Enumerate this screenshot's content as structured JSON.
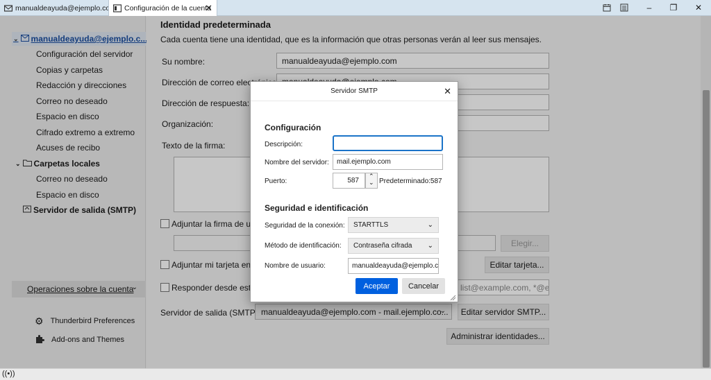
{
  "tabs": [
    {
      "label": "manualdeayuda@ejemplo.com",
      "icon": "mail-icon"
    },
    {
      "label": "Configuración de la cuenta",
      "icon": "settings-tab-icon"
    }
  ],
  "window_controls": {
    "minimize": "–",
    "restore": "❐",
    "close": "✕"
  },
  "sidebar": {
    "account": "manualdeayuda@ejemplo.c...",
    "account_items": [
      "Configuración del servidor",
      "Copias y carpetas",
      "Redacción y direcciones",
      "Correo no deseado",
      "Espacio en disco",
      "Cifrado extremo a extremo",
      "Acuses de recibo"
    ],
    "local_folders": "Carpetas locales",
    "local_items": [
      "Correo no deseado",
      "Espacio en disco"
    ],
    "smtp": "Servidor de salida (SMTP)",
    "ops_button": "Operaciones sobre la cuenta",
    "prefs": "Thunderbird Preferences",
    "addons": "Add-ons and Themes"
  },
  "main": {
    "title": "Identidad predeterminada",
    "description": "Cada cuenta tiene una identidad, que es la información que otras personas verán al leer sus mensajes.",
    "name_label": "Su nombre:",
    "name_value": "manualdeayuda@ejemplo.com",
    "email_label": "Dirección de correo electrónico:",
    "email_value": "manualdeayuda@ejemplo.com",
    "reply_label": "Dirección de respuesta:",
    "org_label": "Organización:",
    "signature_label": "Texto de la firma:",
    "attach_sig_label": "Adjuntar la firma de un archivo",
    "choose_btn": "Elegir...",
    "attach_card_label": "Adjuntar mi tarjeta en los mensajes",
    "edit_card_btn": "Editar tarjeta...",
    "reply_from_label": "Responder desde esta identidad",
    "reply_from_placeholder": "list@example.com, *@ex",
    "smtp_label": "Servidor de salida (SMTP):",
    "smtp_value": "manualdeayuda@ejemplo.com - mail.ejemplo.co...",
    "edit_smtp_btn": "Editar servidor SMTP...",
    "manage_ids_btn": "Administrar identidades..."
  },
  "dialog": {
    "title": "Servidor SMTP",
    "config_title": "Configuración",
    "desc_label": "Descripción:",
    "desc_value": "",
    "server_label": "Nombre del servidor:",
    "server_value": "mail.ejemplo.com",
    "port_label": "Puerto:",
    "port_value": "587",
    "port_default": "Predeterminado:587",
    "security_title": "Seguridad e identificación",
    "conn_label": "Seguridad de la conexión:",
    "conn_value": "STARTTLS",
    "auth_label": "Método de identificación:",
    "auth_value": "Contraseña cifrada",
    "user_label": "Nombre de usuario:",
    "user_value": "manualdeayuda@ejemplo.c",
    "accept": "Aceptar",
    "cancel": "Cancelar"
  },
  "colors": {
    "accent": "#0060df",
    "tabbar": "#d6e4ef",
    "focus": "#1a73c8"
  }
}
